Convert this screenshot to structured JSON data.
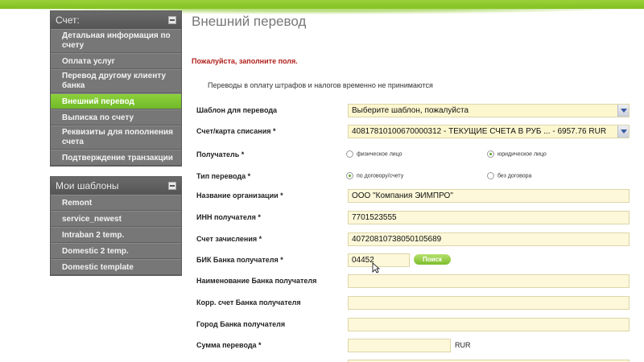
{
  "sidebar": {
    "account": {
      "title": "Счет:",
      "items": [
        {
          "label": "Детальная информация по счету"
        },
        {
          "label": "Оплата услуг"
        },
        {
          "label": "Перевод другому клиенту банка"
        },
        {
          "label": "Внешний перевод",
          "active": true
        },
        {
          "label": "Выписка по счету"
        },
        {
          "label": "Реквизиты для пополнения счета"
        },
        {
          "label": "Подтверждение транзакции"
        }
      ]
    },
    "templates": {
      "title": "Мои шаблоны",
      "items": [
        {
          "label": "Remont"
        },
        {
          "label": "service_newest"
        },
        {
          "label": "Intraban 2 temp."
        },
        {
          "label": "Domestic 2 temp."
        },
        {
          "label": "Domestic template"
        }
      ]
    }
  },
  "main": {
    "title": "Внешний перевод",
    "notice": "Пожалуйста, заполните поля.",
    "info": "Переводы в оплату штрафов и налогов временно не принимаются",
    "form": {
      "template": {
        "label": "Шаблон для перевода",
        "value": "Выберите шаблон, пожалуйста"
      },
      "account": {
        "label": "Счет/карта списания *",
        "value": "40817810100670000312 - ТЕКУЩИЕ СЧЕТА В РУБ ... - 6957.76 RUR"
      },
      "recipient": {
        "label": "Получатель *",
        "option1": "физическое лицо",
        "option2": "юридическое лицо",
        "selected": "option2"
      },
      "transfer_type": {
        "label": "Тип перевода *",
        "option1": "по договору/счету",
        "option2": "без договора",
        "selected": "option1"
      },
      "org_name": {
        "label": "Название организации *",
        "value": "ООО \"Компания ЭИМПРО\""
      },
      "inn": {
        "label": "ИНН получателя *",
        "value": "7701523555"
      },
      "credit_account": {
        "label": "Счет зачисления *",
        "value": "40720810738050105689"
      },
      "bik": {
        "label": "БИК Банка получателя *",
        "value": "04452",
        "search_label": "Поиск"
      },
      "bank_name": {
        "label": "Наименование Банка получателя",
        "value": ""
      },
      "corr_account": {
        "label": "Корр. счет Банка получателя",
        "value": ""
      },
      "bank_city": {
        "label": "Город Банка получателя",
        "value": ""
      },
      "amount": {
        "label": "Сумма перевода *",
        "value": "",
        "currency": "RUR"
      }
    }
  },
  "colors": {
    "accent_green": "#7fbf1f",
    "error_red": "#b0201c",
    "field_bg": "#fdf8d9",
    "sidebar_gray": "#6d6d6d"
  },
  "icons": {
    "toggle": "minus-box-icon",
    "dropdown": "chevron-down-icon",
    "cursor": "mouse-pointer-icon"
  }
}
